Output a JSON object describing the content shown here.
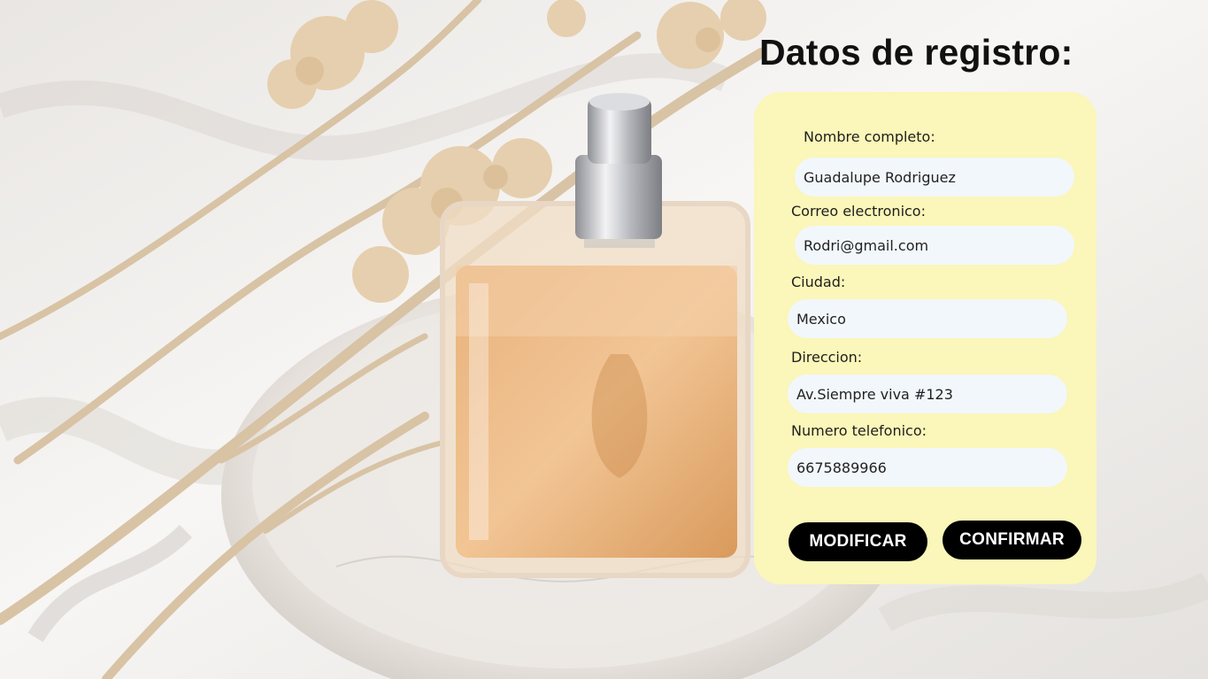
{
  "title": "Datos de registro:",
  "form": {
    "fields": [
      {
        "label": "Nombre completo:",
        "value": "Guadalupe Rodriguez"
      },
      {
        "label": "Correo electronico:",
        "value": "Rodri@gmail.com"
      },
      {
        "label": "Ciudad:",
        "value": "Mexico"
      },
      {
        "label": "Direccion:",
        "value": "Av.Siempre viva #123"
      },
      {
        "label": "Numero telefonico:",
        "value": "6675889966"
      }
    ],
    "buttons": {
      "modify": "MODIFICAR",
      "confirm": "CONFIRMAR"
    }
  },
  "colors": {
    "card": "#fbf6b9",
    "field": "#f2f7fb",
    "button": "#000000"
  }
}
